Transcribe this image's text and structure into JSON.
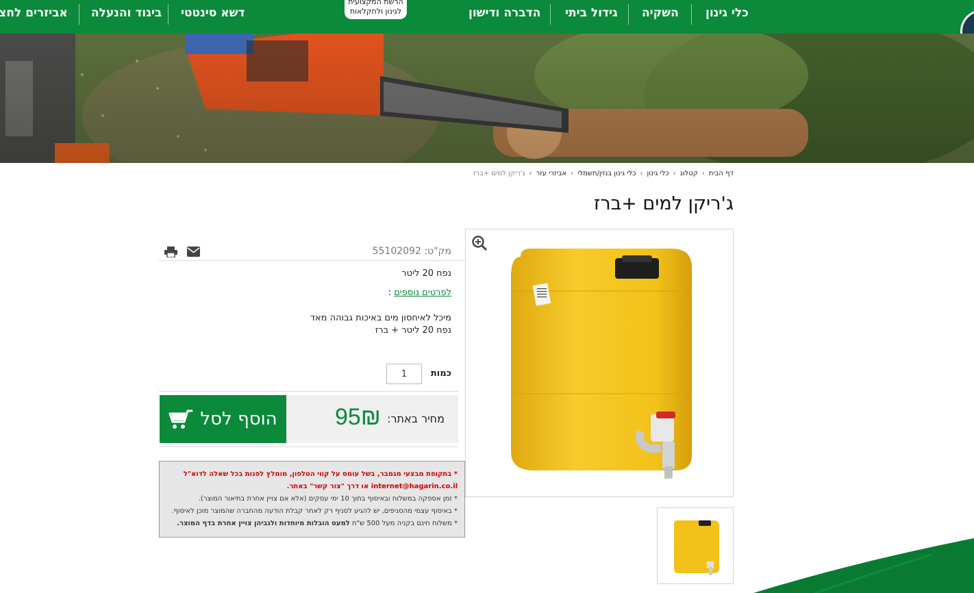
{
  "nav": {
    "items": [
      {
        "label": "כלי גינון"
      },
      {
        "label": "השקיה"
      },
      {
        "label": "גידול ביתי"
      },
      {
        "label": "הדברה ודישון"
      },
      {
        "label": "דשא סינטטי"
      },
      {
        "label": "ביגוד והנעלה"
      },
      {
        "label": "אביזרים לחצר"
      }
    ],
    "logo_line1": "הרשת המקצועית",
    "logo_line2": "לגינון ולחקלאות"
  },
  "breadcrumb": {
    "items": [
      "דף הבית",
      "קטלוג",
      "כלי גינון",
      "כלי גינון בנזין/חשמלי",
      "אביזרי עזר"
    ],
    "current": "ג'ריקן למים +ברז",
    "separator": "›"
  },
  "product": {
    "title": "ג'ריקן למים +ברז",
    "sku_label": "מק\"ט:",
    "sku": "55102092",
    "volume": "נפח 20 ליטר",
    "more_details_link": "לפרטים נוספים",
    "more_details_suffix": ":",
    "description_line1": "מיכל לאיחסון מים באיכות גבוהה מאד",
    "description_line2": "נפח 20 ליטר + ברז",
    "quantity_label": "כמות",
    "quantity_value": "1",
    "price_label": "מחיר באתר:",
    "price": "95₪",
    "add_to_cart": "הוסף לסל"
  },
  "notice": {
    "line1": "* בתקופת מבצעי מגמבר, בשל עומס על קווי הטלפון, מומלץ לפנות בכל שאלה לדוא\"ל",
    "line2": "internet@hagarin.co.il או דרך \"צור קשר\" באתר.",
    "line3": "* זמן אספקה במשלוח ובאיסוף בתוך 10 ימי עסקים (אלא אם צויין אחרת בתיאור המוצר).",
    "line4": "* באיסוף עצמי מהסניפים, יש להגיע לסניף רק לאחר קבלת הודעה מהחברה שהמוצר מוכן לאיסוף.",
    "line5_prefix": "* משלוח חינם בקניה מעל 500 ש\"ח",
    "line5_bold": "למעט הובלות מיוחדות ולגביהן צויין אחרת בדף המוצר."
  },
  "colors": {
    "brand_green": "#0a8a3a",
    "price_green": "#0a8a3a",
    "notice_red": "#d00000",
    "jerrycan_yellow": "#f2c21a"
  },
  "icons": [
    "zoom-in-icon",
    "mail-icon",
    "print-icon",
    "cart-icon"
  ]
}
